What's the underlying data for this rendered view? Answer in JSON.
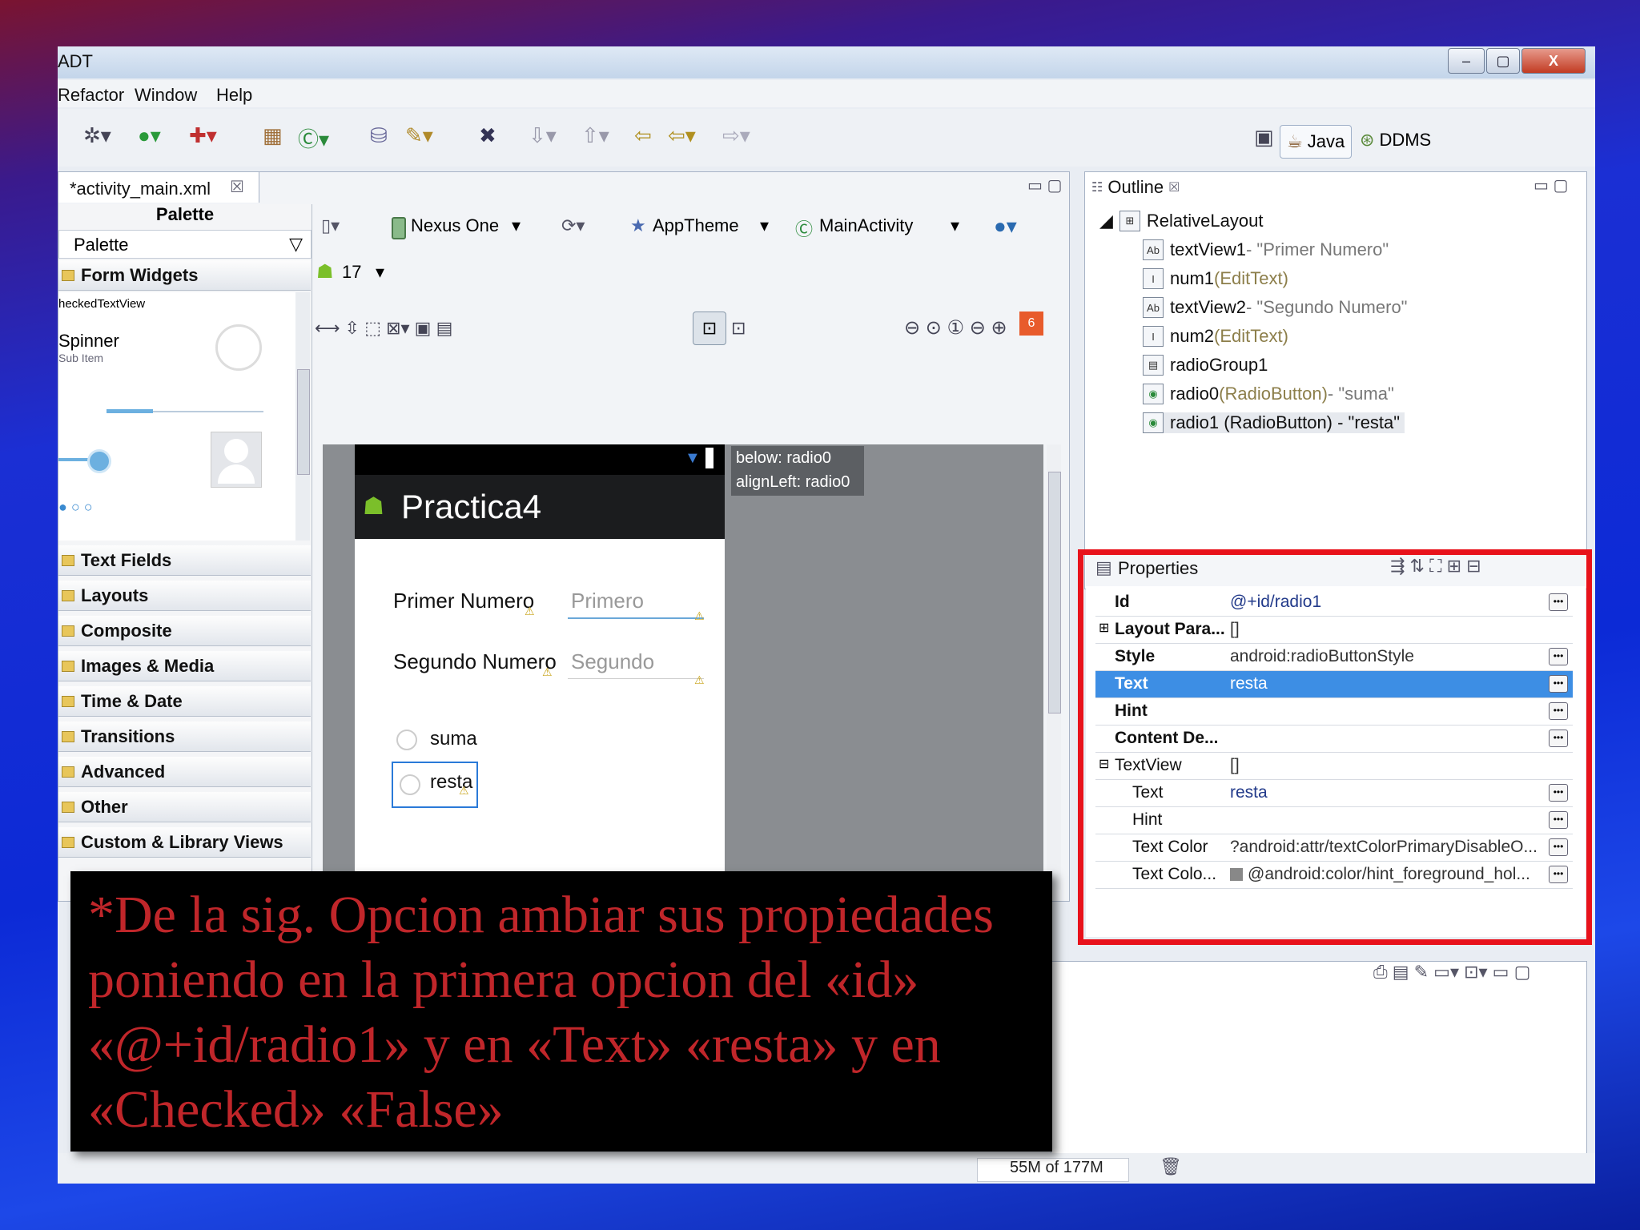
{
  "window": {
    "title": "ADT",
    "controls": {
      "minimize": "–",
      "maximize": "▢",
      "close": "X"
    }
  },
  "menu": [
    "Refactor",
    "Window",
    "Help"
  ],
  "perspectives": {
    "java": "Java",
    "ddms": "DDMS"
  },
  "editor": {
    "tab_label": "*activity_main.xml",
    "device": "Nexus One",
    "theme": "AppTheme",
    "activity": "MainActivity",
    "api_level": "17",
    "error_count": "6"
  },
  "palette": {
    "header": "Palette",
    "dropdown_label": "Palette",
    "section": "Form Widgets",
    "widget_caption": "heckedTextView",
    "spinner_label": "Spinner",
    "spinner_sub": "Sub Item",
    "categories": [
      "Text Fields",
      "Layouts",
      "Composite",
      "Images & Media",
      "Time & Date",
      "Transitions",
      "Advanced",
      "Other",
      "Custom & Library Views"
    ]
  },
  "preview": {
    "app_title": "Practica4",
    "tooltip_line1": "below: radio0",
    "tooltip_line2": "alignLeft: radio0",
    "label1": "Primer Numero",
    "hint1": "Primero",
    "label2": "Segundo Numero",
    "hint2": "Segundo",
    "radio1": "suma",
    "radio2": "resta"
  },
  "outline": {
    "tab_label": "Outline",
    "root": "RelativeLayout",
    "items": [
      {
        "name": "textView1",
        "type": "",
        "text": " - \"Primer Numero\"",
        "icon": "Ab"
      },
      {
        "name": "num1",
        "type": " (EditText)",
        "text": "",
        "icon": "I"
      },
      {
        "name": "textView2",
        "type": "",
        "text": " - \"Segundo Numero\"",
        "icon": "Ab"
      },
      {
        "name": "num2",
        "type": " (EditText)",
        "text": "",
        "icon": "I"
      },
      {
        "name": "radioGroup1",
        "type": "",
        "text": "",
        "icon": "▤"
      },
      {
        "name": "radio0",
        "type": " (RadioButton)",
        "text": " - \"suma\"",
        "icon": "◉"
      },
      {
        "name": "radio1 (RadioButton) - \"resta\"",
        "type": "",
        "text": "",
        "icon": "◉"
      }
    ]
  },
  "properties": {
    "tab_label": "Properties",
    "rows": [
      {
        "key": "Id",
        "value": "@+id/radio1",
        "indent": false,
        "expander": "",
        "dots": true
      },
      {
        "key": "Layout Para...",
        "value": "[]",
        "indent": false,
        "expander": "⊞",
        "dots": false
      },
      {
        "key": "Style",
        "value": "android:radioButtonStyle",
        "indent": false,
        "expander": "",
        "dots": true
      },
      {
        "key": "Text",
        "value": "resta",
        "indent": false,
        "expander": "",
        "dots": true,
        "selected": true
      },
      {
        "key": "Hint",
        "value": "",
        "indent": false,
        "expander": "",
        "dots": true
      },
      {
        "key": "Content De...",
        "value": "",
        "indent": false,
        "expander": "",
        "dots": true
      },
      {
        "key": "TextView",
        "value": "[]",
        "indent": false,
        "expander": "⊟",
        "dots": false
      },
      {
        "key": "Text",
        "value": "resta",
        "indent": true,
        "expander": "",
        "dots": true
      },
      {
        "key": "Hint",
        "value": "",
        "indent": true,
        "expander": "",
        "dots": true
      },
      {
        "key": "Text Color",
        "value": "?android:attr/textColorPrimaryDisableO...",
        "indent": true,
        "expander": "",
        "dots": true
      },
      {
        "key": "Text Colo...",
        "value": "@android:color/hint_foreground_hol...",
        "indent": true,
        "expander": "",
        "dots": true
      }
    ]
  },
  "status": {
    "memory": "55M of 177M"
  },
  "caption": "*De la sig. Opcion ambiar sus propiedades poniendo en la primera opcion  del «id» «@+id/radio1» y en «Text» «resta» y en «Checked» «False»",
  "colors": {
    "highlight_box": "#e8121b",
    "selection": "#3d8ee4",
    "caption_text": "#c0262a"
  }
}
